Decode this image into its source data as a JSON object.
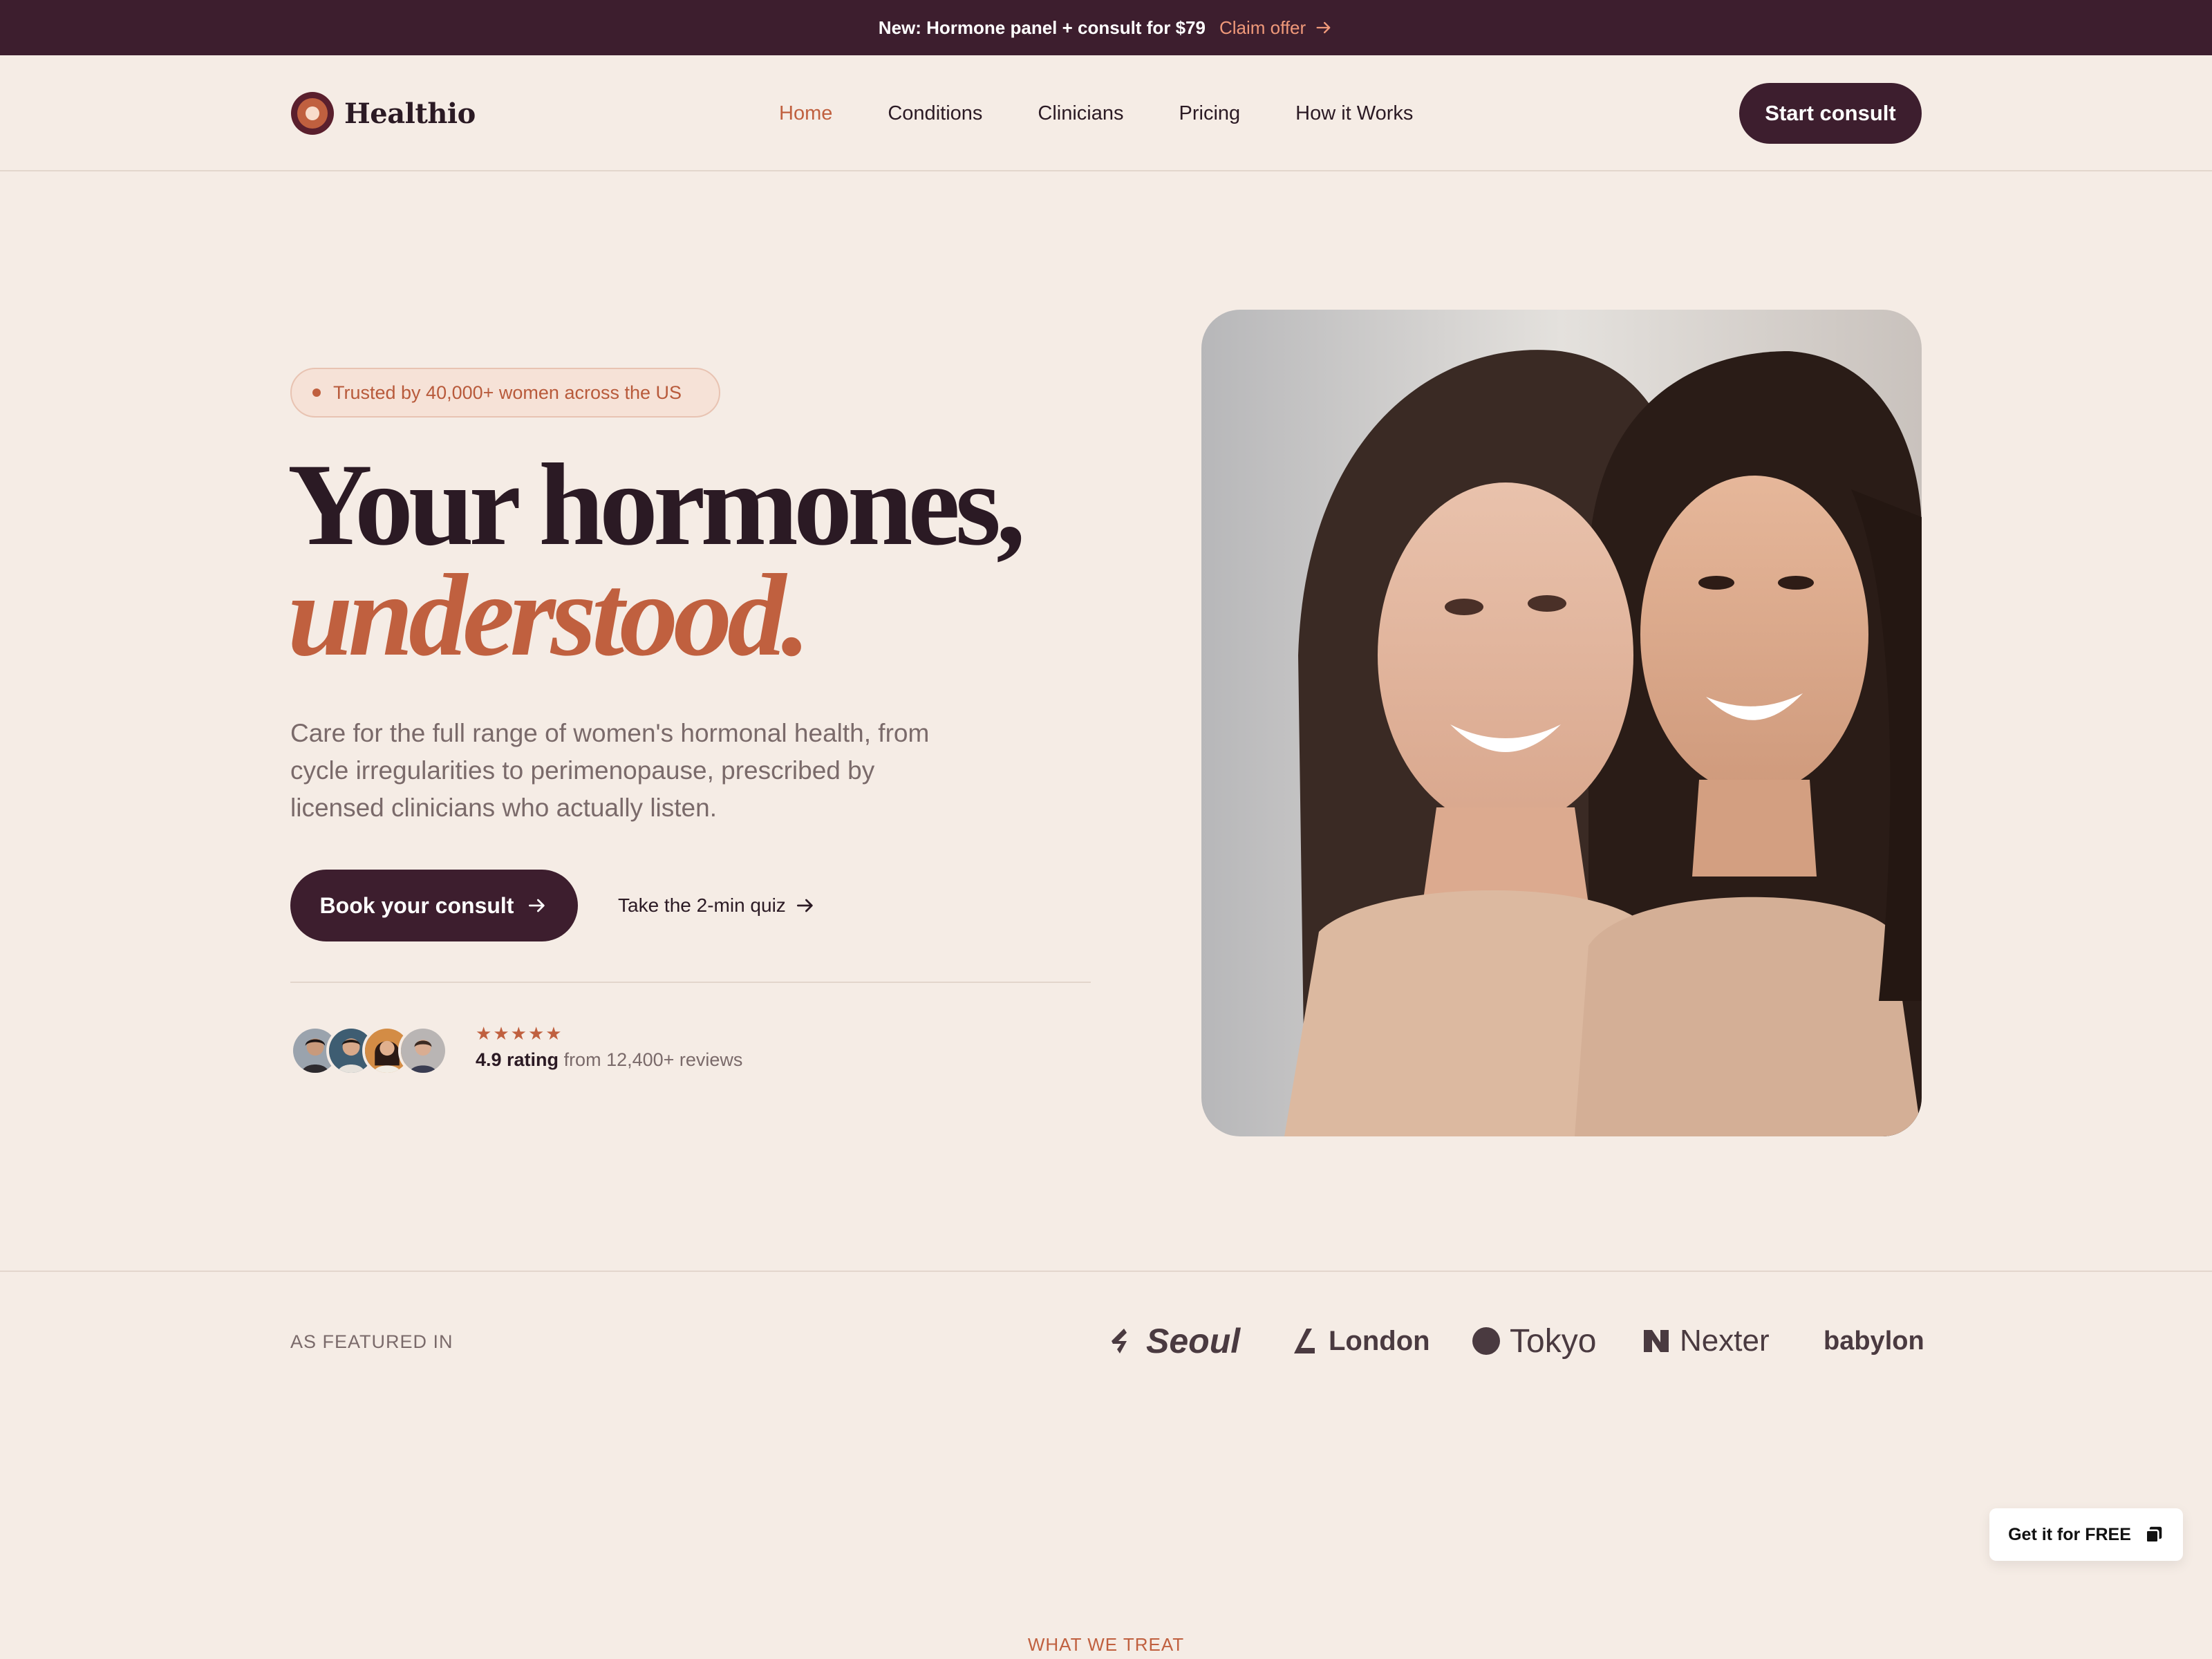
{
  "announcement": {
    "message": "New: Hormone panel + consult for $79",
    "cta": "Claim offer"
  },
  "brand": {
    "name": "Healthio"
  },
  "nav": {
    "links": [
      "Home",
      "Conditions",
      "Clinicians",
      "Pricing",
      "How it Works"
    ],
    "active": "Home",
    "cta": "Start consult"
  },
  "hero": {
    "badge": "Trusted by 40,000+ women across the US",
    "title_line1": "Your hormones,",
    "title_line2": "understood.",
    "subtitle": "Care for the full range of women's hormonal health, from cycle irregularities to perimenopause, prescribed by licensed clinicians who actually listen.",
    "primary_cta": "Book your consult",
    "secondary_cta": "Take the 2-min quiz",
    "rating_value": "4.9 rating",
    "rating_text": "from 12,400+ reviews",
    "stars": 5
  },
  "featured": {
    "label": "AS FEATURED IN",
    "brands": [
      "Seoul",
      "London",
      "Tokyo",
      "Nexter",
      "babylon"
    ]
  },
  "floating_badge": {
    "label": "Get it for FREE"
  },
  "next_section": {
    "eyebrow": "WHAT WE TREAT"
  },
  "colors": {
    "background": "#f5ece5",
    "plum": "#3d1e2e",
    "accent": "#c0603f",
    "muted_text": "#7a6a6a"
  }
}
